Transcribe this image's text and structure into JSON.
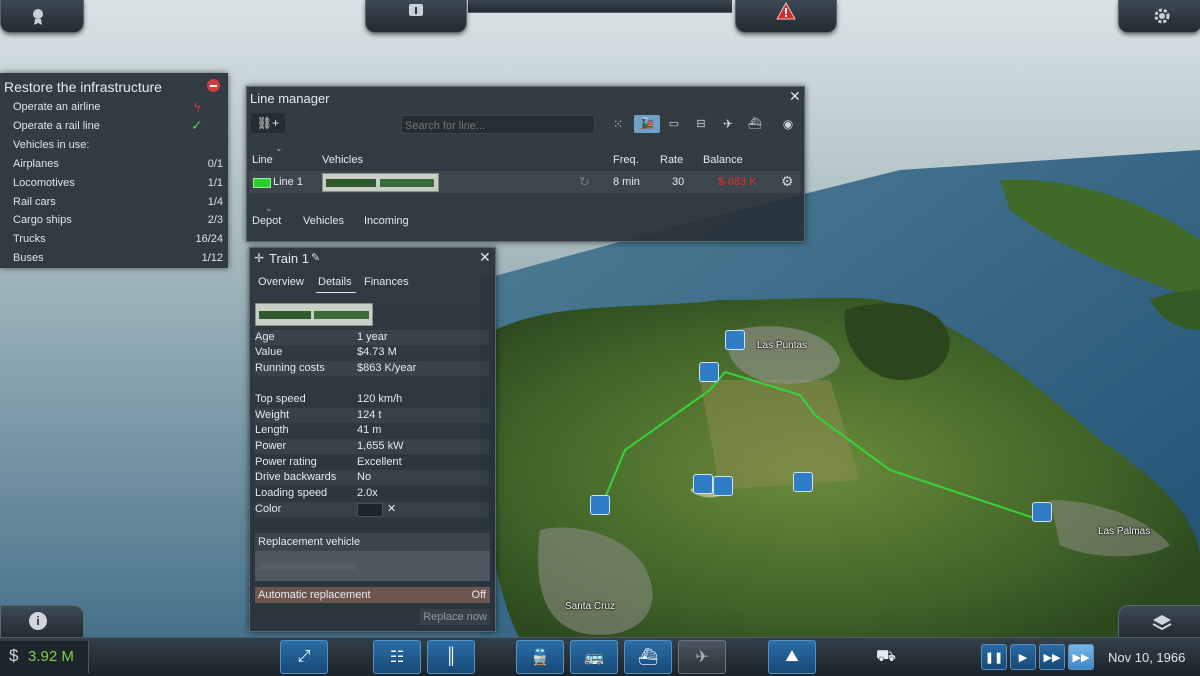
{
  "top": {
    "left_icon": "medal-icon",
    "info_icon": "info-icon",
    "warning_icon": "warning-triangle-icon",
    "settings_icon": "gear-icon"
  },
  "objectives": {
    "title": "Restore the infrastructure",
    "rows": [
      {
        "label": "Operate an airline",
        "value": "",
        "status": "fail"
      },
      {
        "label": "Operate a rail line",
        "value": "",
        "status": "done"
      },
      {
        "label": "Vehicles in use:",
        "value": ""
      },
      {
        "label": "Airplanes",
        "value": "0/1"
      },
      {
        "label": "Locomotives",
        "value": "1/1"
      },
      {
        "label": "Rail cars",
        "value": "1/4"
      },
      {
        "label": "Cargo ships",
        "value": "2/3"
      },
      {
        "label": "Trucks",
        "value": "16/24"
      },
      {
        "label": "Buses",
        "value": "1/12"
      }
    ]
  },
  "line_manager": {
    "title": "Line manager",
    "search_placeholder": "Search for line...",
    "filters": [
      "all-icon",
      "train-icon",
      "bus-icon",
      "tram-icon",
      "plane-icon",
      "ship-icon"
    ],
    "columns": {
      "line": "Line",
      "vehicles": "Vehicles",
      "freq": "Freq.",
      "rate": "Rate",
      "balance": "Balance"
    },
    "rows": [
      {
        "name": "Line 1",
        "color": "#28d028",
        "freq": "8 min",
        "rate": "30",
        "balance": "$-683 K"
      }
    ],
    "tabs": [
      "Depot",
      "Vehicles",
      "Incoming"
    ]
  },
  "train": {
    "title": "Train 1",
    "tabs": [
      "Overview",
      "Details",
      "Finances"
    ],
    "active_tab": "Details",
    "group1": [
      {
        "k": "Age",
        "v": "1 year"
      },
      {
        "k": "Value",
        "v": "$4.73 M"
      },
      {
        "k": "Running costs",
        "v": "$863 K/year"
      }
    ],
    "group2": [
      {
        "k": "Top speed",
        "v": "120 km/h"
      },
      {
        "k": "Weight",
        "v": "124 t"
      },
      {
        "k": "Length",
        "v": "41 m"
      },
      {
        "k": "Power",
        "v": "1,655 kW"
      },
      {
        "k": "Power rating",
        "v": "Excellent"
      },
      {
        "k": "Drive backwards",
        "v": "No"
      },
      {
        "k": "Loading speed",
        "v": "2.0x"
      }
    ],
    "color_label": "Color",
    "replacement_label": "Replacement vehicle",
    "auto_label": "Automatic replacement",
    "auto_value": "Off",
    "replace_button": "Replace now"
  },
  "map_labels": {
    "las_puntas": "Las Puntas",
    "las_palmas": "Las Palmas",
    "santa_cruz": "Santa Cruz"
  },
  "bottom": {
    "money": "3.92 M",
    "currency": "$",
    "date": "Nov 10, 1966",
    "tools": [
      "route-icon",
      "rail-icon",
      "road-icon",
      "train-depot-icon",
      "bus-depot-icon",
      "ship-depot-icon",
      "airport-icon",
      "terrain-icon",
      "bulldozer-icon"
    ],
    "colors": {
      "money": "#7ed04a",
      "negative": "#e03030",
      "accent": "#2a6ea6"
    }
  }
}
